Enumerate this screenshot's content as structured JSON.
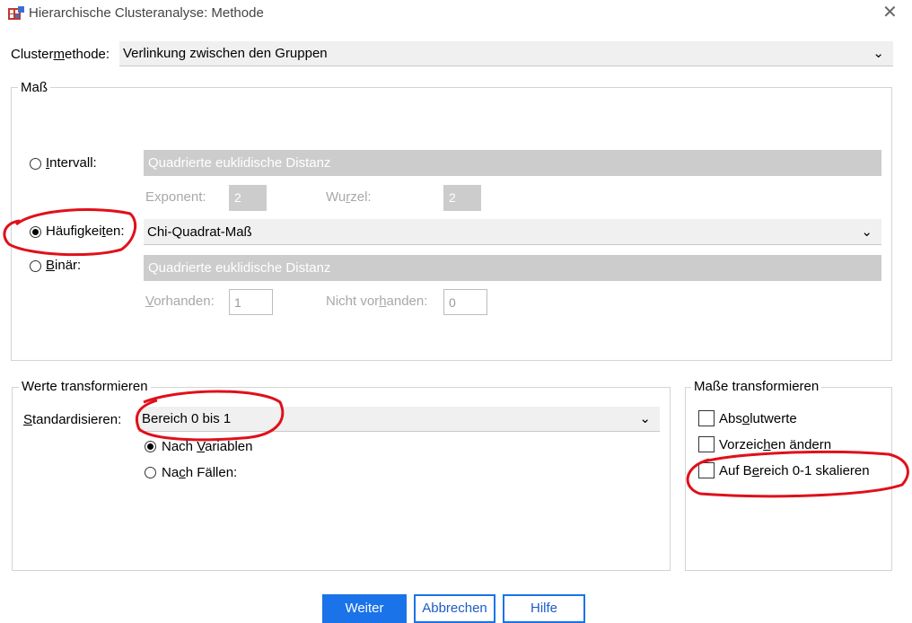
{
  "window": {
    "title": "Hierarchische Clusteranalyse: Methode",
    "close_icon": "close-icon"
  },
  "cluster_method": {
    "label": "Clustermethode:",
    "value": "Verlinkung zwischen den Gruppen"
  },
  "measure": {
    "legend": "Maß",
    "interval": {
      "label": "Intervall:",
      "value": "Quadrierte euklidische Distanz",
      "selected": false,
      "exponent_label": "Exponent:",
      "exponent_value": "2",
      "root_label": "Wurzel:",
      "root_value": "2"
    },
    "frequencies": {
      "label": "Häufigkeiten:",
      "value": "Chi-Quadrat-Maß",
      "selected": true
    },
    "binary": {
      "label": "Binär:",
      "value": "Quadrierte euklidische Distanz",
      "selected": false,
      "present_label": "Vorhanden:",
      "present_value": "1",
      "absent_label": "Nicht vorhanden:",
      "absent_value": "0"
    }
  },
  "transform_values": {
    "legend": "Werte transformieren",
    "standardize_label": "Standardisieren:",
    "standardize_value": "Bereich 0 bis 1",
    "by_variables": "Nach Variablen",
    "by_cases": "Nach Fällen:",
    "by_variables_selected": true
  },
  "transform_measures": {
    "legend": "Maße transformieren",
    "absolute": "Absolutwerte",
    "change_sign": "Vorzeichen ändern",
    "rescale": "Auf Bereich 0-1 skalieren"
  },
  "buttons": {
    "continue": "Weiter",
    "cancel": "Abbrechen",
    "help": "Hilfe"
  },
  "colors": {
    "primary": "#1a73e8",
    "annotation": "#e0101a"
  }
}
